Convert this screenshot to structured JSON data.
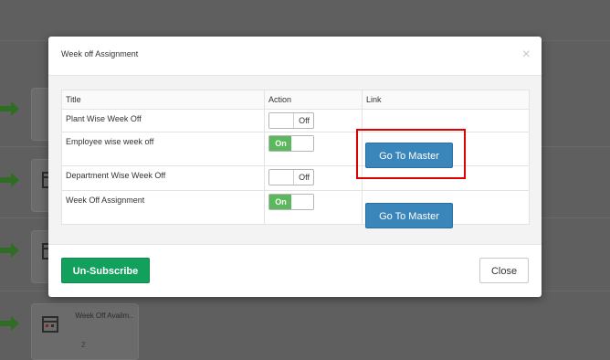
{
  "background": {
    "card": {
      "title": "Week Off Availm..",
      "count": "2"
    }
  },
  "modal": {
    "title": "Week off Assignment",
    "close_icon": "×",
    "table": {
      "headers": {
        "title": "Title",
        "action": "Action",
        "link": "Link"
      },
      "rows": [
        {
          "title": "Plant Wise Week Off",
          "toggle": "Off",
          "link": ""
        },
        {
          "title": "Employee wise week off",
          "toggle": "On",
          "link": "Go To Master"
        },
        {
          "title": "Department Wise Week Off",
          "toggle": "Off",
          "link": ""
        },
        {
          "title": "Week Off Assignment",
          "toggle": "On",
          "link": "Go To Master"
        }
      ]
    },
    "footer": {
      "unsubscribe_label": "Un-Subscribe",
      "close_label": "Close"
    }
  },
  "colors": {
    "on_green": "#5cb85c",
    "master_blue": "#3a85ba",
    "unsubscribe_green": "#12a05c",
    "highlight_red": "#e00000"
  }
}
